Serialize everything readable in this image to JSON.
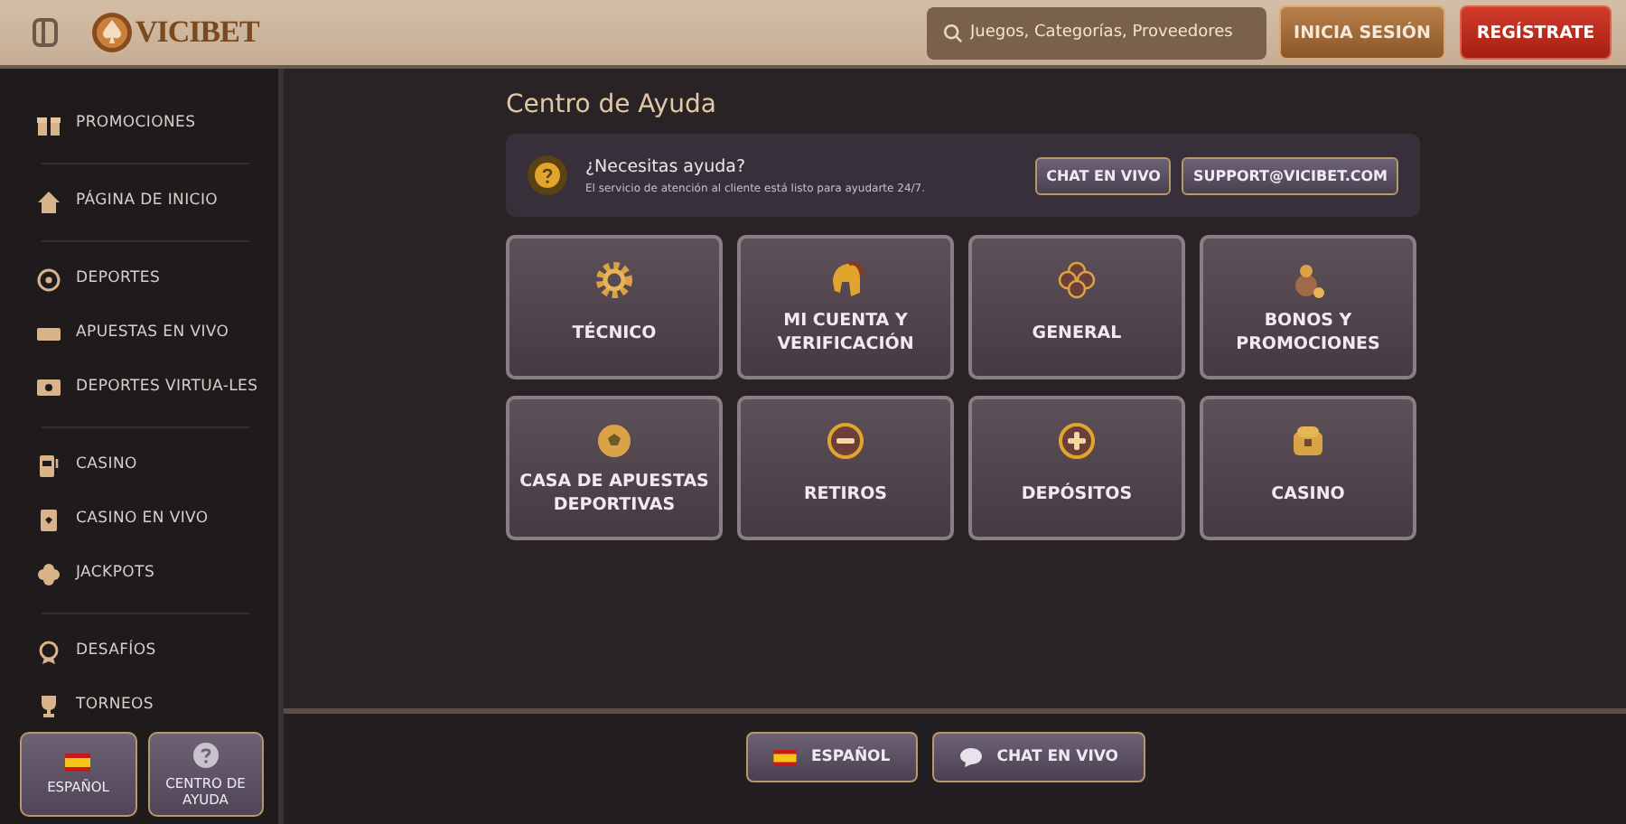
{
  "header": {
    "logo": "VICIBET",
    "search": {
      "placeholder": "Juegos, Categorías, Proveedores"
    },
    "login": "INICIA SESIÓN",
    "register": "REGÍSTRATE"
  },
  "sidebar": {
    "groups": [
      [
        {
          "label": "PROMOCIONES"
        }
      ],
      [
        {
          "label": "PÁGINA DE INICIO"
        }
      ],
      [
        {
          "label": "DEPORTES"
        },
        {
          "label": "APUESTAS EN VIVO"
        },
        {
          "label": "DEPORTES VIRTUA-LES"
        }
      ],
      [
        {
          "label": "CASINO"
        },
        {
          "label": "CASINO EN VIVO"
        },
        {
          "label": "JACKPOTS"
        }
      ],
      [
        {
          "label": "DESAFÍOS"
        },
        {
          "label": "TORNEOS"
        }
      ]
    ],
    "bottom_buttons": [
      "ESPAÑOL",
      "CENTRO DE AYUDA"
    ]
  },
  "help": {
    "title": "Centro de Ayuda",
    "banner": {
      "heading": "¿Necesitas ayuda?",
      "text": "El servicio de atención al cliente está listo para ayudarte 24/7.",
      "buttons": [
        "CHAT EN VIVO",
        "SUPPORT@VICIBET.COM"
      ]
    },
    "categories": [
      "TÉCNICO",
      "MI CUENTA Y VERIFICACIÓN",
      "GENERAL",
      "BONOS Y PROMOCIONES",
      "CASA DE APUESTAS DEPORTIVAS",
      "RETIROS",
      "DEPÓSITOS",
      "CASINO"
    ]
  },
  "footer": {
    "buttons": [
      "ESPAÑOL",
      "CHAT EN VIVO"
    ]
  }
}
